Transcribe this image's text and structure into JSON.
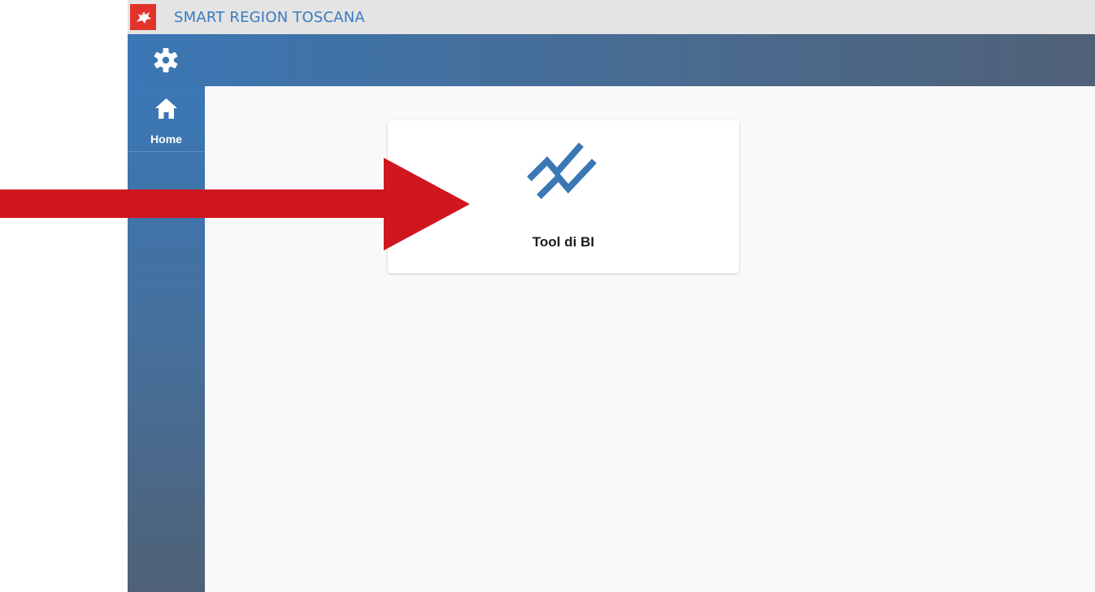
{
  "brand": {
    "title": "SMART REGION TOSCANA",
    "logo_icon": "pegasus-flag-logo",
    "logo_color": "#e2332a",
    "title_color": "#3b7bbf"
  },
  "topbar": {
    "settings_icon": "gear-icon",
    "color_start": "#3a77b5",
    "color_end": "#506278"
  },
  "sidebar": {
    "items": [
      {
        "label": "Home",
        "icon": "home-icon"
      }
    ]
  },
  "main": {
    "cards": [
      {
        "label": "Tool di BI",
        "icon": "trend-chart-icon",
        "icon_color": "#3a77b5"
      }
    ]
  },
  "annotation": {
    "arrow_color": "#d0161f",
    "arrow_direction": "right",
    "points_to": "Tool di BI"
  }
}
